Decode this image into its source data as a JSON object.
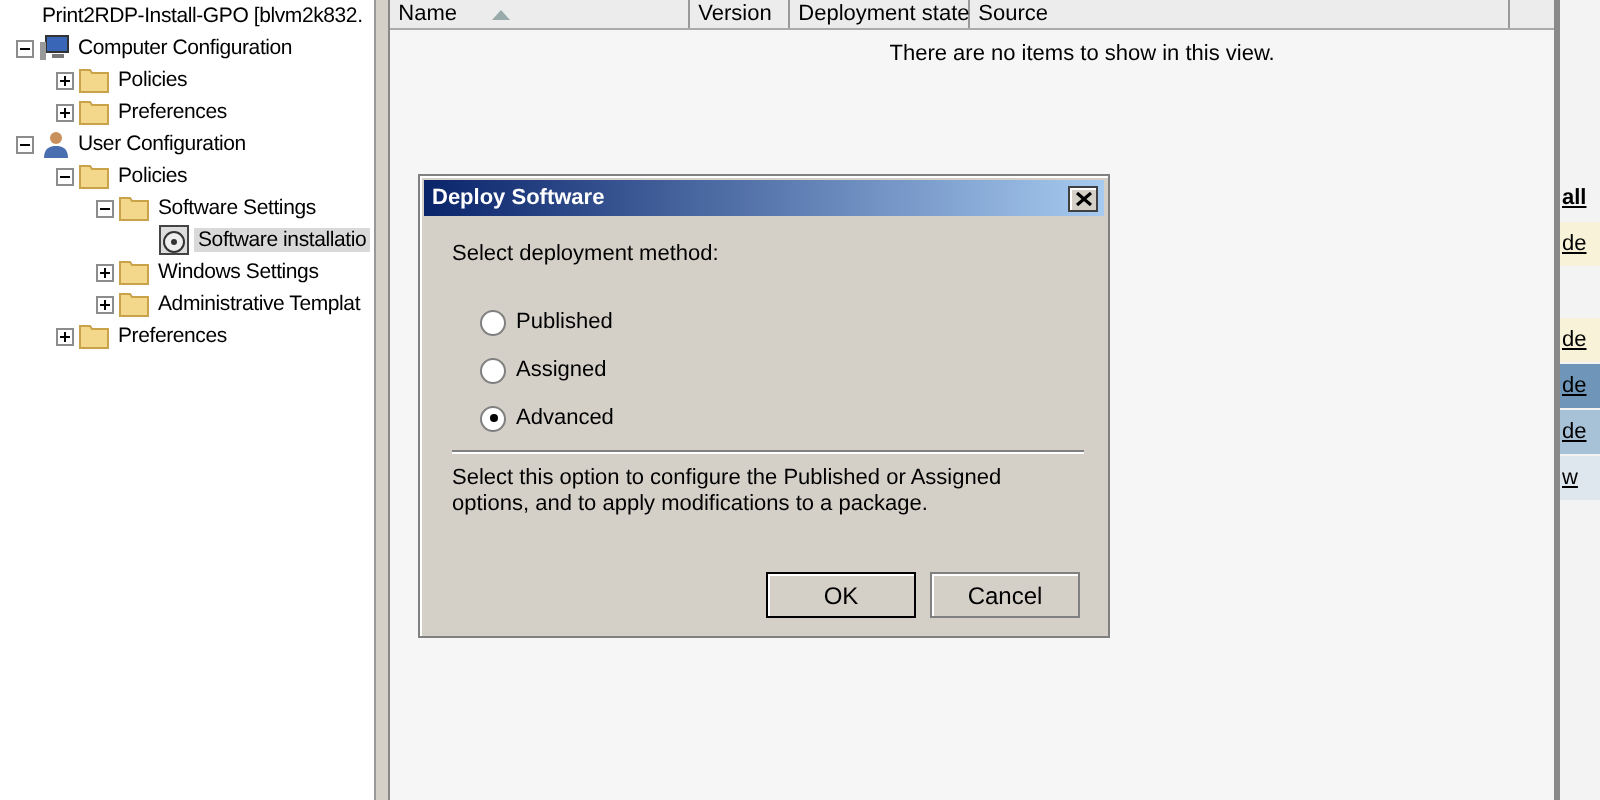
{
  "tree": [
    {
      "label": "Print2RDP-Install-GPO [blvm2k832.",
      "children": [
        {
          "label": "Computer Configuration",
          "kind": "computer",
          "expanded": true,
          "children": [
            {
              "label": "Policies",
              "kind": "folder",
              "expanded": false
            },
            {
              "label": "Preferences",
              "kind": "folder",
              "expanded": false
            }
          ]
        },
        {
          "label": "User Configuration",
          "kind": "user",
          "expanded": true,
          "children": [
            {
              "label": "Policies",
              "kind": "folder",
              "expanded": true,
              "children": [
                {
                  "label": "Software Settings",
                  "kind": "folder",
                  "expanded": true,
                  "children": [
                    {
                      "label": "Software installatio",
                      "kind": "disc",
                      "selected": true
                    }
                  ]
                },
                {
                  "label": "Windows Settings",
                  "kind": "folder",
                  "expanded": false
                },
                {
                  "label": "Administrative Templat",
                  "kind": "folder",
                  "expanded": false
                }
              ]
            },
            {
              "label": "Preferences",
              "kind": "folder",
              "expanded": false
            }
          ]
        }
      ]
    }
  ],
  "list": {
    "columns": [
      {
        "label": "Name",
        "sorted": true
      },
      {
        "label": "Version"
      },
      {
        "label": "Deployment state"
      },
      {
        "label": "Source"
      }
    ],
    "empty_message": "There are no items to show in this view."
  },
  "actions": [
    {
      "label": "all",
      "kind": "heading"
    },
    {
      "label": "de",
      "kind": "yellow"
    },
    {
      "label": "de",
      "kind": "yellow"
    },
    {
      "label": "de",
      "kind": "blue"
    },
    {
      "label": "de",
      "kind": "lightblue"
    },
    {
      "label": "w",
      "kind": "plain"
    }
  ],
  "dialog": {
    "title": "Deploy Software",
    "prompt": "Select deployment method:",
    "options": [
      {
        "label": "Published",
        "selected": false
      },
      {
        "label": "Assigned",
        "selected": false
      },
      {
        "label": "Advanced",
        "selected": true
      }
    ],
    "description": "Select this option to configure the Published or Assigned options, and to apply modifications to a package.",
    "buttons": [
      {
        "label": "OK",
        "default": true
      },
      {
        "label": "Cancel",
        "default": false
      }
    ]
  }
}
